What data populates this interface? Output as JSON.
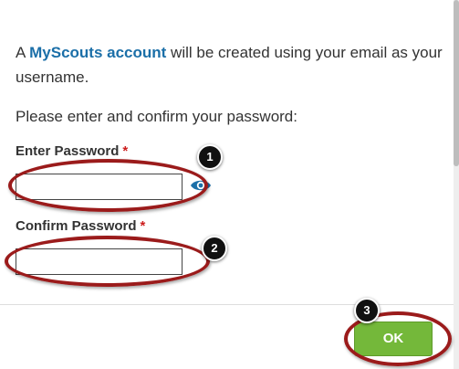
{
  "intro": {
    "prefix": "A ",
    "link_text": "MyScouts account",
    "suffix": " will be created using your email as your username."
  },
  "prompt": "Please enter and confirm your password:",
  "fields": {
    "password": {
      "label": "Enter Password",
      "required_mark": "*",
      "value": "",
      "icon": "eye-icon"
    },
    "confirm": {
      "label": "Confirm Password",
      "required_mark": "*",
      "value": ""
    }
  },
  "ok_button": {
    "label": "OK"
  },
  "annotations": [
    {
      "number": "1"
    },
    {
      "number": "2"
    },
    {
      "number": "3"
    }
  ],
  "colors": {
    "link": "#1b6fa8",
    "required": "#cc1d1d",
    "ok_button": "#74b83a",
    "annotation_ring": "#9b1b1b"
  }
}
